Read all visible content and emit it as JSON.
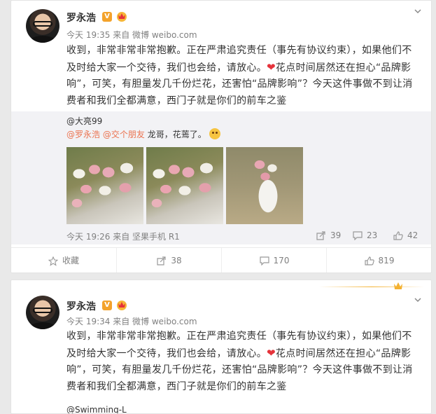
{
  "posts": [
    {
      "author": "罗永浩",
      "v_badge": "V",
      "meta": "今天 19:35 来自 微博 weibo.com",
      "text_a": "收到，非常非常非常抱歉。正在严肃追究责任（事先有协议约束），如果他们不及时给大家一个交待，我们也会给，请放心。",
      "heart": "❤",
      "text_b": "花点时间居然还在担心“品牌影响”，可笑，有胆量发几千份烂花，还害怕“品牌影响”？今天这件事做不到让消费者和我们全都满意，西门子就是你们的前车之鉴",
      "repost": {
        "user": "@大亮99",
        "mention1": "@罗永浩",
        "mention2": "@交个朋友",
        "text": "龙哥，花蔫了。",
        "meta": "今天 19:26 来自 坚果手机 R1",
        "reposts": "39",
        "comments": "23",
        "likes": "42"
      },
      "footer": {
        "favorite": "收藏",
        "repost": "38",
        "comment": "170",
        "like": "819"
      }
    },
    {
      "author": "罗永浩",
      "v_badge": "V",
      "meta": "今天 19:34 来自 微博 weibo.com",
      "text_a": "收到，非常非常非常抱歉。正在严肃追究责任（事先有协议约束），如果他们不及时给大家一个交待，我们也会给，请放心。",
      "heart": "❤",
      "text_b": "花点时间居然还在担心“品牌影响”，可笑，有胆量发几千份烂花，还害怕“品牌影响”？今天这件事做不到让消费者和我们全都满意，西门子就是你们的前车之鉴",
      "next_text": "@Swimming-L"
    }
  ],
  "colors": {
    "link": "#eb7350",
    "badge": "#f3a22b",
    "heart": "#e5333b"
  },
  "icons": [
    "chevron-down-icon",
    "repost-icon",
    "comment-icon",
    "like-icon",
    "star-icon",
    "crown-icon"
  ]
}
